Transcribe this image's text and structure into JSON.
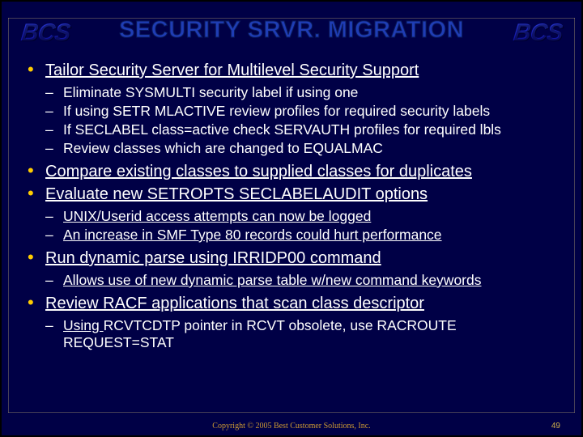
{
  "logo": "BCS",
  "title": "SECURITY SRVR. MIGRATION",
  "bullets": [
    {
      "text": "Tailor Security Server for Multilevel Security Support",
      "subs": [
        {
          "text": "Eliminate SYSMULTI security label if using one",
          "style": "d-lg"
        },
        {
          "text": "If using SETR MLACTIVE review profiles for required security labels",
          "style": "d-lg"
        },
        {
          "text": "If SECLABEL class=active check SERVAUTH profiles for required lbls",
          "style": "d-lg"
        },
        {
          "text": "Review classes which are changed to EQUALMAC",
          "style": "d-lg"
        }
      ]
    },
    {
      "text": "Compare existing classes to supplied classes  for duplicates",
      "subs": []
    },
    {
      "text": "Evaluate new SETROPTS SECLABELAUDIT options",
      "subs": [
        {
          "text": "UNIX/Userid access attempts can now be logged",
          "style": "d-sm"
        },
        {
          "text": "An increase in SMF Type 80 records could hurt performance",
          "style": "d-sm"
        }
      ]
    },
    {
      "text": "Run dynamic parse using IRRIDP00 command",
      "subs": [
        {
          "text": "Allows use of new dynamic parse table w/new command keywords",
          "style": "d-sm"
        }
      ]
    },
    {
      "text": "Review RACF applications that scan class descriptor",
      "subs": [
        {
          "prefix": "Using ",
          "rest": "RCVTCDTP pointer in RCVT obsolete, use RACROUTE REQUEST=STAT",
          "split": true
        }
      ]
    }
  ],
  "footer": "Copyright © 2005 Best Customer Solutions, Inc.",
  "page": "49"
}
